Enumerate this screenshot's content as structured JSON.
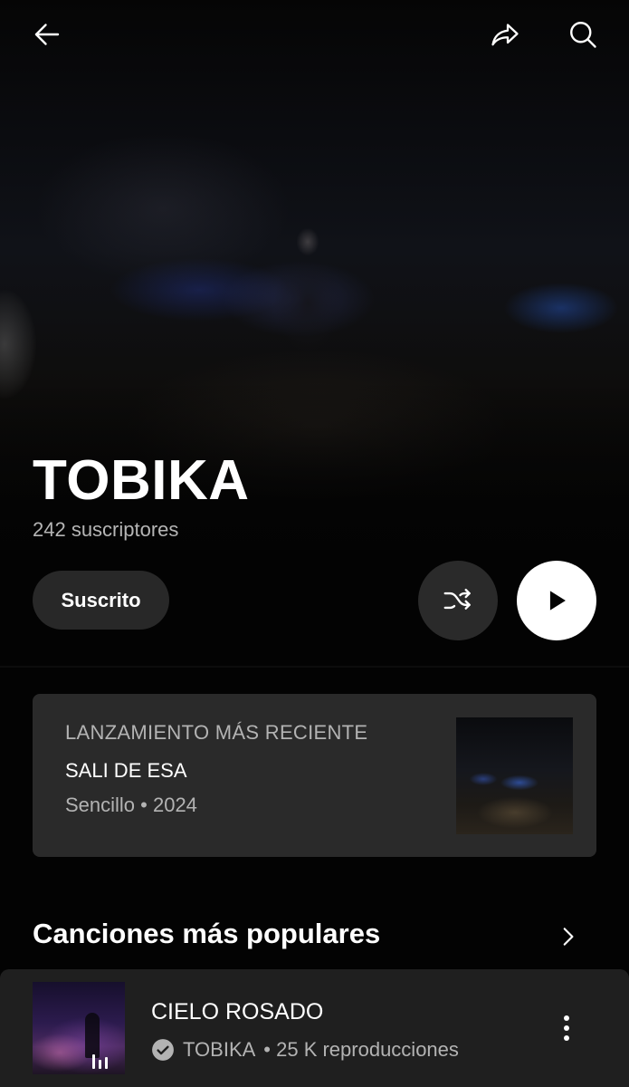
{
  "header": {
    "back_icon": "arrow-back-icon",
    "share_icon": "share-icon",
    "search_icon": "search-icon"
  },
  "artist": {
    "name": "TOBIKA",
    "subscribers": "242 suscriptores"
  },
  "actions": {
    "subscribe_label": "Suscrito",
    "shuffle_icon": "shuffle-icon",
    "play_icon": "play-icon"
  },
  "latest_release": {
    "kicker": "LANZAMIENTO MÁS RECIENTE",
    "title": "SALI DE ESA",
    "meta": "Sencillo • 2024"
  },
  "popular_songs": {
    "section_title": "Canciones más populares",
    "chevron_icon": "chevron-right-icon",
    "songs": [
      {
        "title": "CIELO ROSADO",
        "artist": "TOBIKA",
        "plays": "• 25 K reproducciones",
        "status_icon": "equalizer-playing-icon",
        "more_icon": "more-vertical-icon"
      }
    ]
  },
  "colors": {
    "background": "#030303",
    "card": "#2a2a2a",
    "secondary_text": "#b3b3b3",
    "play_button": "#ffffff"
  }
}
